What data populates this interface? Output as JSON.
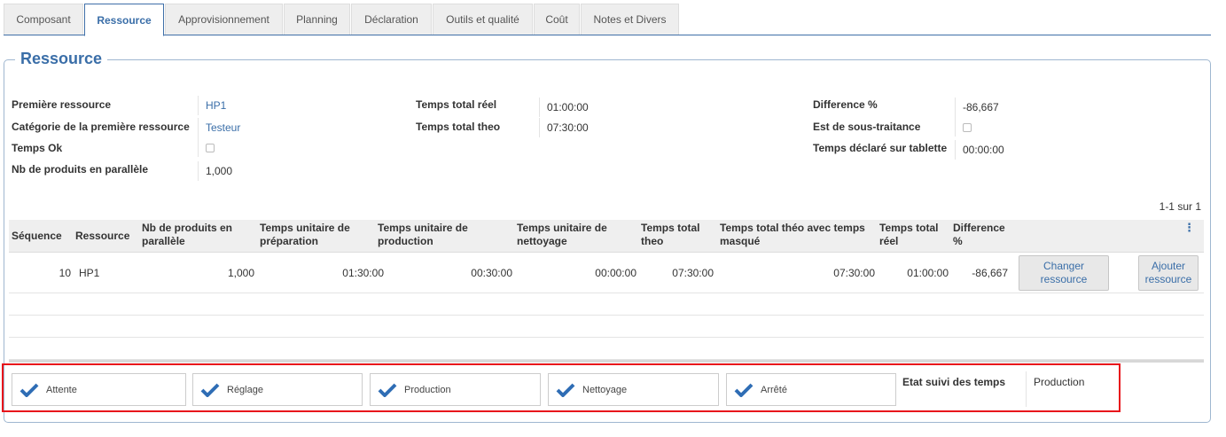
{
  "tabs": [
    {
      "label": "Composant",
      "active": false
    },
    {
      "label": "Ressource",
      "active": true
    },
    {
      "label": "Approvisionnement",
      "active": false
    },
    {
      "label": "Planning",
      "active": false
    },
    {
      "label": "Déclaration",
      "active": false
    },
    {
      "label": "Outils et qualité",
      "active": false
    },
    {
      "label": "Coût",
      "active": false
    },
    {
      "label": "Notes et Divers",
      "active": false
    }
  ],
  "section": {
    "title": "Ressource"
  },
  "fields": {
    "premiere_ressource": {
      "label": "Première ressource",
      "value": "HP1"
    },
    "categorie": {
      "label": "Catégorie de la première ressource",
      "value": "Testeur"
    },
    "temps_ok": {
      "label": "Temps Ok",
      "checked": false
    },
    "nb_produits": {
      "label": "Nb de produits en parallèle",
      "value": "1,000"
    },
    "temps_total_reel": {
      "label": "Temps total réel",
      "value": "01:00:00"
    },
    "temps_total_theo": {
      "label": "Temps total theo",
      "value": "07:30:00"
    },
    "difference": {
      "label": "Difference %",
      "value": "-86,667"
    },
    "sous_traitance": {
      "label": "Est de sous-traitance",
      "checked": false
    },
    "temps_tablette": {
      "label": "Temps déclaré sur tablette",
      "value": "00:00:00"
    }
  },
  "pager": "1-1 sur 1",
  "table": {
    "columns": [
      "Séquence",
      "Ressource",
      "Nb de produits en parallèle",
      "Temps unitaire de préparation",
      "Temps unitaire de production",
      "Temps unitaire de nettoyage",
      "Temps total theo",
      "Temps total théo avec temps masqué",
      "Temps total réel",
      "Difference %"
    ],
    "rows": [
      {
        "sequence": "10",
        "ressource": "HP1",
        "nb_produits": "1,000",
        "t_preparation": "01:30:00",
        "t_production": "00:30:00",
        "t_nettoyage": "00:00:00",
        "t_total_theo": "07:30:00",
        "t_total_theo_masque": "07:30:00",
        "t_total_reel": "01:00:00",
        "difference": "-86,667",
        "btn_changer": "Changer ressource",
        "btn_ajouter": "Ajouter ressource"
      }
    ],
    "options_icon": "kebab-menu-icon"
  },
  "status": {
    "items": [
      {
        "label": "Attente",
        "icon": "check-icon"
      },
      {
        "label": "Réglage",
        "icon": "check-icon"
      },
      {
        "label": "Production",
        "icon": "check-icon"
      },
      {
        "label": "Nettoyage",
        "icon": "check-icon"
      },
      {
        "label": "Arrêté",
        "icon": "check-icon"
      }
    ],
    "etat_label": "Etat suivi des temps",
    "etat_value": "Production",
    "check_color": "#2f6db5",
    "highlight_color": "#e8141b"
  }
}
